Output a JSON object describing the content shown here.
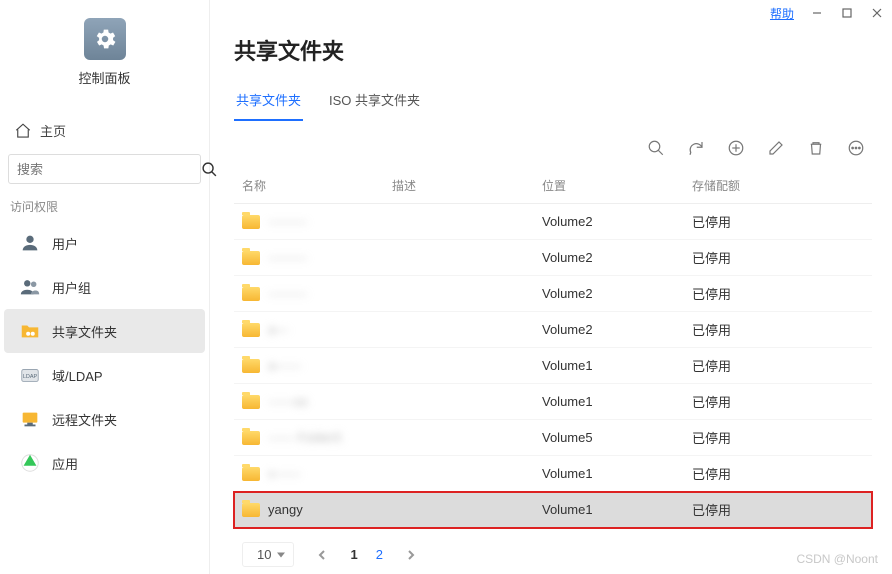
{
  "titlebar": {
    "help": "帮助"
  },
  "sidebar": {
    "title": "控制面板",
    "home": "主页",
    "search_placeholder": "搜索",
    "section_label": "访问权限",
    "items": [
      {
        "label": "用户"
      },
      {
        "label": "用户组"
      },
      {
        "label": "共享文件夹"
      },
      {
        "label": "域/LDAP"
      },
      {
        "label": "远程文件夹"
      },
      {
        "label": "应用"
      }
    ]
  },
  "main": {
    "title": "共享文件夹",
    "tabs": [
      {
        "label": "共享文件夹",
        "active": true
      },
      {
        "label": "ISO 共享文件夹",
        "active": false
      }
    ],
    "columns": {
      "name": "名称",
      "desc": "描述",
      "loc": "位置",
      "quota": "存储配额"
    },
    "rows": [
      {
        "name": "———",
        "desc": "",
        "loc": "Volume2",
        "quota": "已停用",
        "blur": true
      },
      {
        "name": "———",
        "desc": "",
        "loc": "Volume2",
        "quota": "已停用",
        "blur": true
      },
      {
        "name": "———",
        "desc": "",
        "loc": "Volume2",
        "quota": "已停用",
        "blur": true
      },
      {
        "name": "a—",
        "desc": "",
        "loc": "Volume2",
        "quota": "已停用",
        "blur": true
      },
      {
        "name": "a——",
        "desc": "",
        "loc": "Volume1",
        "quota": "已停用",
        "blur": true
      },
      {
        "name": "——os",
        "desc": "",
        "loc": "Volume1",
        "quota": "已停用",
        "blur": true
      },
      {
        "name": "—— Folder5",
        "desc": "",
        "loc": "Volume5",
        "quota": "已停用",
        "blur": true
      },
      {
        "name": "v——",
        "desc": "",
        "loc": "Volume1",
        "quota": "已停用",
        "blur": true
      },
      {
        "name": "yangy",
        "desc": "",
        "loc": "Volume1",
        "quota": "已停用",
        "blur": false,
        "highlight": true
      }
    ],
    "pager": {
      "size": "10",
      "pages": [
        "1",
        "2"
      ],
      "current": 1
    }
  },
  "watermark": "CSDN @Noont"
}
